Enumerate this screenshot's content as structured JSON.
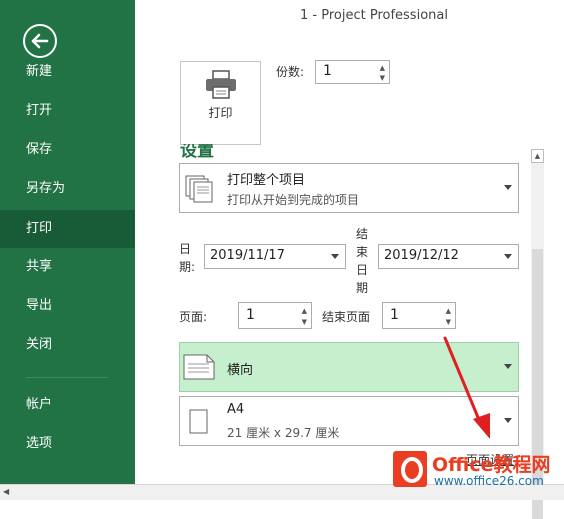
{
  "window": {
    "title": "1 - Project Professional"
  },
  "sidebar": {
    "items": [
      {
        "label": "新建"
      },
      {
        "label": "打开"
      },
      {
        "label": "保存"
      },
      {
        "label": "另存为"
      },
      {
        "label": "打印",
        "active": true
      },
      {
        "label": "共享"
      },
      {
        "label": "导出"
      },
      {
        "label": "关闭"
      },
      {
        "label": "帐户"
      },
      {
        "label": "选项"
      }
    ]
  },
  "print": {
    "button_label": "打印",
    "copies_label": "份数:",
    "copies_value": "1"
  },
  "settings": {
    "section_title": "设置",
    "range": {
      "title": "打印整个项目",
      "subtitle": "打印从开始到完成的项目"
    },
    "start_date": {
      "label_a": "日",
      "label_b": "期:",
      "value": "2019/11/17"
    },
    "end_date": {
      "label_a": "结",
      "label_b": "束",
      "label_c": "日",
      "label_d": "期",
      "value": "2019/12/12"
    },
    "page": {
      "label": "页面:",
      "value": "1"
    },
    "end_page": {
      "label": "结束页面",
      "value": "1"
    },
    "orientation": {
      "value": "横向"
    },
    "paper": {
      "title": "A4",
      "subtitle": "21 厘米 x 29.7 厘米"
    },
    "page_setup_link": "页面设置"
  },
  "watermark": {
    "brand_text": "Office教程网",
    "url": "www.office26.com"
  },
  "colors": {
    "sidebar": "#217346",
    "sidebar_active": "#185c37",
    "highlight": "#c6efce",
    "accent_red": "#ea3e23"
  }
}
